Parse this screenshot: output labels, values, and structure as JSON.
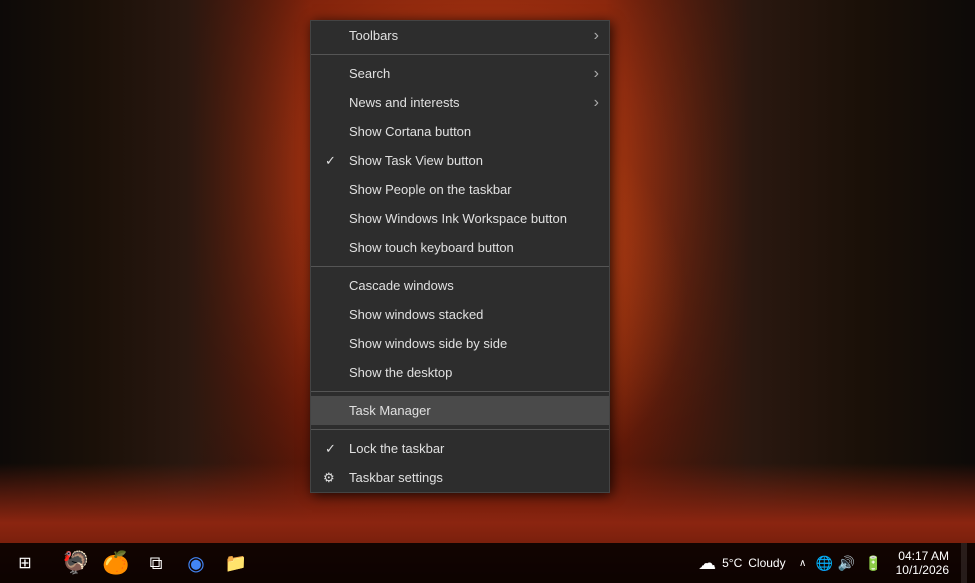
{
  "desktop": {
    "background_description": "Autumn forest with orange-red foliage"
  },
  "context_menu": {
    "items": [
      {
        "id": "toolbars",
        "label": "Toolbars",
        "has_arrow": true,
        "checked": false,
        "separator_after": false,
        "highlighted": false
      },
      {
        "id": "separator1",
        "type": "separator"
      },
      {
        "id": "search",
        "label": "Search",
        "has_arrow": true,
        "checked": false,
        "separator_after": false,
        "highlighted": false
      },
      {
        "id": "news-interests",
        "label": "News and interests",
        "has_arrow": true,
        "checked": false,
        "separator_after": false,
        "highlighted": false
      },
      {
        "id": "show-cortana",
        "label": "Show Cortana button",
        "has_arrow": false,
        "checked": false,
        "separator_after": false,
        "highlighted": false
      },
      {
        "id": "show-task-view",
        "label": "Show Task View button",
        "has_arrow": false,
        "checked": true,
        "separator_after": false,
        "highlighted": false
      },
      {
        "id": "show-people",
        "label": "Show People on the taskbar",
        "has_arrow": false,
        "checked": false,
        "separator_after": false,
        "highlighted": false
      },
      {
        "id": "show-ink",
        "label": "Show Windows Ink Workspace button",
        "has_arrow": false,
        "checked": false,
        "separator_after": false,
        "highlighted": false
      },
      {
        "id": "show-touch",
        "label": "Show touch keyboard button",
        "has_arrow": false,
        "checked": false,
        "separator_after": true,
        "highlighted": false
      },
      {
        "id": "separator2",
        "type": "separator"
      },
      {
        "id": "cascade",
        "label": "Cascade windows",
        "has_arrow": false,
        "checked": false,
        "separator_after": false,
        "highlighted": false
      },
      {
        "id": "show-stacked",
        "label": "Show windows stacked",
        "has_arrow": false,
        "checked": false,
        "separator_after": false,
        "highlighted": false
      },
      {
        "id": "show-side-by-side",
        "label": "Show windows side by side",
        "has_arrow": false,
        "checked": false,
        "separator_after": false,
        "highlighted": false
      },
      {
        "id": "show-desktop",
        "label": "Show the desktop",
        "has_arrow": false,
        "checked": false,
        "separator_after": true,
        "highlighted": false
      },
      {
        "id": "separator3",
        "type": "separator"
      },
      {
        "id": "task-manager",
        "label": "Task Manager",
        "has_arrow": false,
        "checked": false,
        "separator_after": true,
        "highlighted": true
      },
      {
        "id": "separator4",
        "type": "separator"
      },
      {
        "id": "lock-taskbar",
        "label": "Lock the taskbar",
        "has_arrow": false,
        "checked": true,
        "separator_after": false,
        "highlighted": false
      },
      {
        "id": "taskbar-settings",
        "label": "Taskbar settings",
        "has_arrow": false,
        "checked": false,
        "separator_after": false,
        "highlighted": false,
        "has_gear": true
      }
    ]
  },
  "taskbar": {
    "weather": {
      "temp": "5°C",
      "condition": "Cloudy"
    },
    "icons": [
      {
        "id": "start",
        "symbol": "⊞"
      },
      {
        "id": "task-view",
        "symbol": "❑"
      },
      {
        "id": "chrome",
        "symbol": "⬤"
      },
      {
        "id": "explorer",
        "symbol": "📁"
      }
    ],
    "tray": {
      "up_arrow": "∧",
      "network": "🌐",
      "speaker": "🔊",
      "battery": "🔋"
    }
  }
}
